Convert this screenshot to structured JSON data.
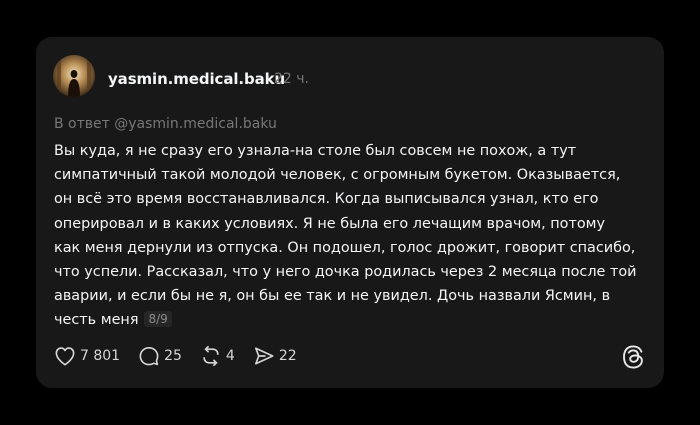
{
  "post": {
    "username": "yasmin.medical.baku",
    "time": "22 ч.",
    "reply_to": "В ответ @yasmin.medical.baku",
    "text": "Вы куда, я не сразу его узнала-на столе был совсем не похож, а тут\nсимпатичный такой молодой человек, с огромным букетом. Оказывается,\nон всё это время восстанавливался. Когда выписывался узнал, кто его\nоперировал и в каких условиях. Я не была его лечащим врачом, потому\nкак меня дернули из отпуска. Он подошел, голос дрожит, говорит спасибо,\nчто успели. Рассказал, что у него дочка родилась через 2 месяца после той\nаварии, и если бы не я, он бы ее так и не увидел. Дочь назвали Ясмин, в\nчесть меня",
    "page_indicator": "8/9"
  },
  "actions": {
    "likes": "7 801",
    "comments": "25",
    "reposts": "4",
    "shares": "22"
  },
  "icons": {
    "like": "heart-icon",
    "comment": "comment-bubble-icon",
    "repost": "repost-icon",
    "share": "send-icon",
    "brand": "threads-logo-icon"
  },
  "colors": {
    "background": "#000000",
    "card": "#181818",
    "text": "#f3f5f7",
    "muted": "#777777"
  }
}
